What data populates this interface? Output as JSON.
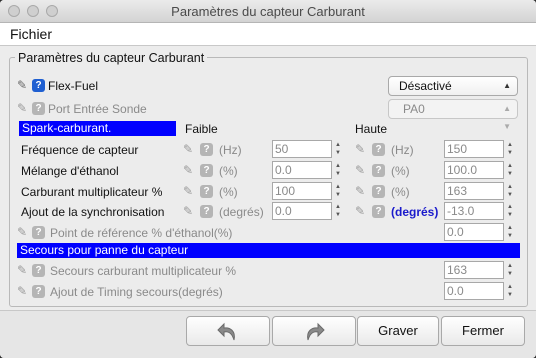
{
  "window": {
    "title": "Paramètres du capteur Carburant"
  },
  "menu": {
    "file": "Fichier"
  },
  "group": {
    "title": "Paramètres du capteur Carburant"
  },
  "flexfuel": {
    "label": "Flex-Fuel",
    "value": "Désactivé"
  },
  "port": {
    "label": "Port Entrée Sonde",
    "value": "PA0"
  },
  "spark": {
    "header": "Spark-carburant.",
    "col_low": "Faible",
    "col_high": "Haute",
    "rows": [
      {
        "label": "Fréquence de capteur",
        "unit": "(Hz)",
        "low": "50",
        "unit_high": "(Hz)",
        "high": "150"
      },
      {
        "label": "Mélange d'éthanol",
        "unit": "(%)",
        "low": "0.0",
        "unit_high": "(%)",
        "high": "100.0"
      },
      {
        "label": "Carburant multiplicateur %",
        "unit": "(%)",
        "low": "100",
        "unit_high": "(%)",
        "high": "163"
      },
      {
        "label": "Ajout de la synchronisation",
        "unit": "(degrés)",
        "low": "0.0",
        "unit_high": "(degrés)",
        "high": "-13.0"
      }
    ]
  },
  "reference": {
    "label": "Point de référence % d'éthanol(%)",
    "value": "0.0"
  },
  "backup": {
    "header": "Secours pour panne du capteur",
    "fuel_label": "Secours carburant multiplicateur %",
    "fuel_value": "163",
    "timing_label": "Ajout de Timing secours(degrés)",
    "timing_value": "0.0"
  },
  "buttons": {
    "burn": "Graver",
    "close": "Fermer"
  },
  "colors": {
    "header_bg": "#0000ff",
    "help_active": "#1f5fd1"
  }
}
